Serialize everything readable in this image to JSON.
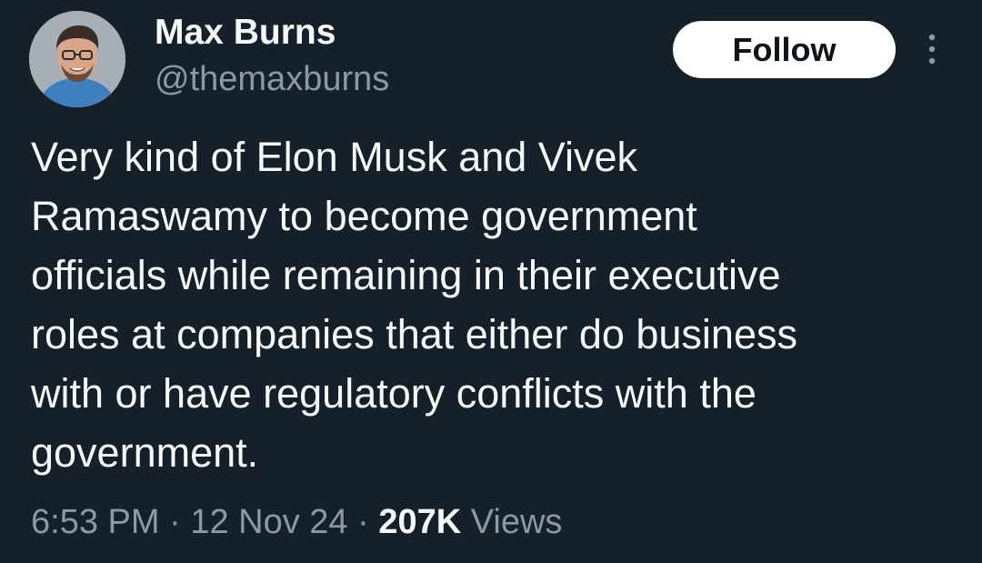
{
  "author": {
    "display_name": "Max Burns",
    "handle": "@themaxburns",
    "avatar_icon": "profile-photo"
  },
  "actions": {
    "follow_label": "Follow",
    "more_icon": "vertical-ellipsis-icon"
  },
  "tweet": {
    "text": "Very kind of Elon Musk and Vivek\nRamaswamy to become government\nofficials while remaining in their executive\nroles at companies that either do business\nwith or have regulatory conflicts with the\ngovernment."
  },
  "meta": {
    "time": "6:53 PM",
    "separator": "·",
    "date": "12 Nov 24",
    "views_count": "207K",
    "views_label": "Views"
  },
  "colors": {
    "background": "#15202b",
    "primary_text": "#f7f9f9",
    "secondary_text": "#8b98a5",
    "follow_bg": "#ffffff"
  }
}
